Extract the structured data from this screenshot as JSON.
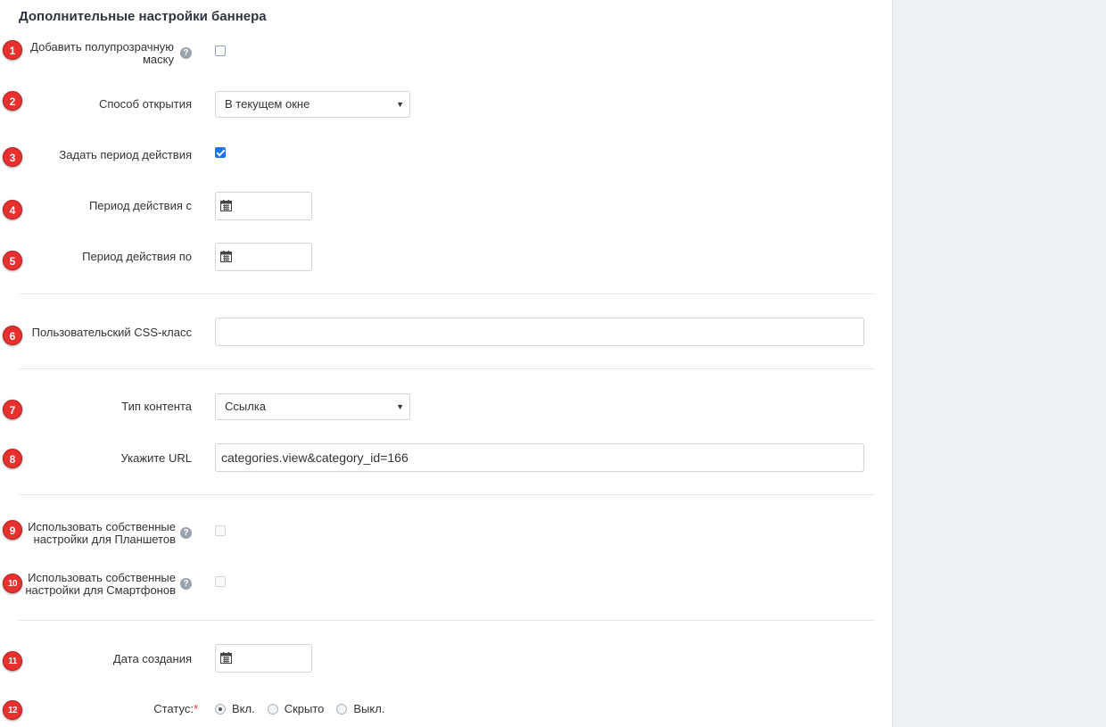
{
  "section_title": "Дополнительные настройки баннера",
  "help_glyph": "?",
  "calendar_icon": "calendar-icon",
  "colors": {
    "badge": "#e8302f",
    "checkbox_checked": "#1a73e8",
    "sidebar": "#eef1f4"
  },
  "fields": {
    "mask": {
      "badge": "1",
      "label": "Добавить полупрозрачную маску",
      "checked": false
    },
    "open_method": {
      "badge": "2",
      "label": "Способ открытия",
      "value": "В текущем окне"
    },
    "set_period": {
      "badge": "3",
      "label": "Задать период действия",
      "checked": true
    },
    "period_from": {
      "badge": "4",
      "label": "Период действия с",
      "value": ""
    },
    "period_to": {
      "badge": "5",
      "label": "Период действия по",
      "value": ""
    },
    "css_class": {
      "badge": "6",
      "label": "Пользовательский CSS-класс",
      "value": ""
    },
    "content_type": {
      "badge": "7",
      "label": "Тип контента",
      "value": "Ссылка"
    },
    "url": {
      "badge": "8",
      "label": "Укажите URL",
      "value": "categories.view&category_id=166"
    },
    "tablet": {
      "badge": "9",
      "label_line1": "Использовать собственные",
      "label_line2": "настройки для Планшетов",
      "checked": false
    },
    "smartphone": {
      "badge": "10",
      "label_line1": "Использовать собственные",
      "label_line2": "настройки для Смартфонов",
      "checked": false
    },
    "created": {
      "badge": "11",
      "label": "Дата создания",
      "value": ""
    },
    "status": {
      "badge": "12",
      "label": "Статус:",
      "required_mark": "*",
      "options": [
        "Вкл.",
        "Скрыто",
        "Выкл."
      ],
      "selected": "Вкл."
    }
  }
}
